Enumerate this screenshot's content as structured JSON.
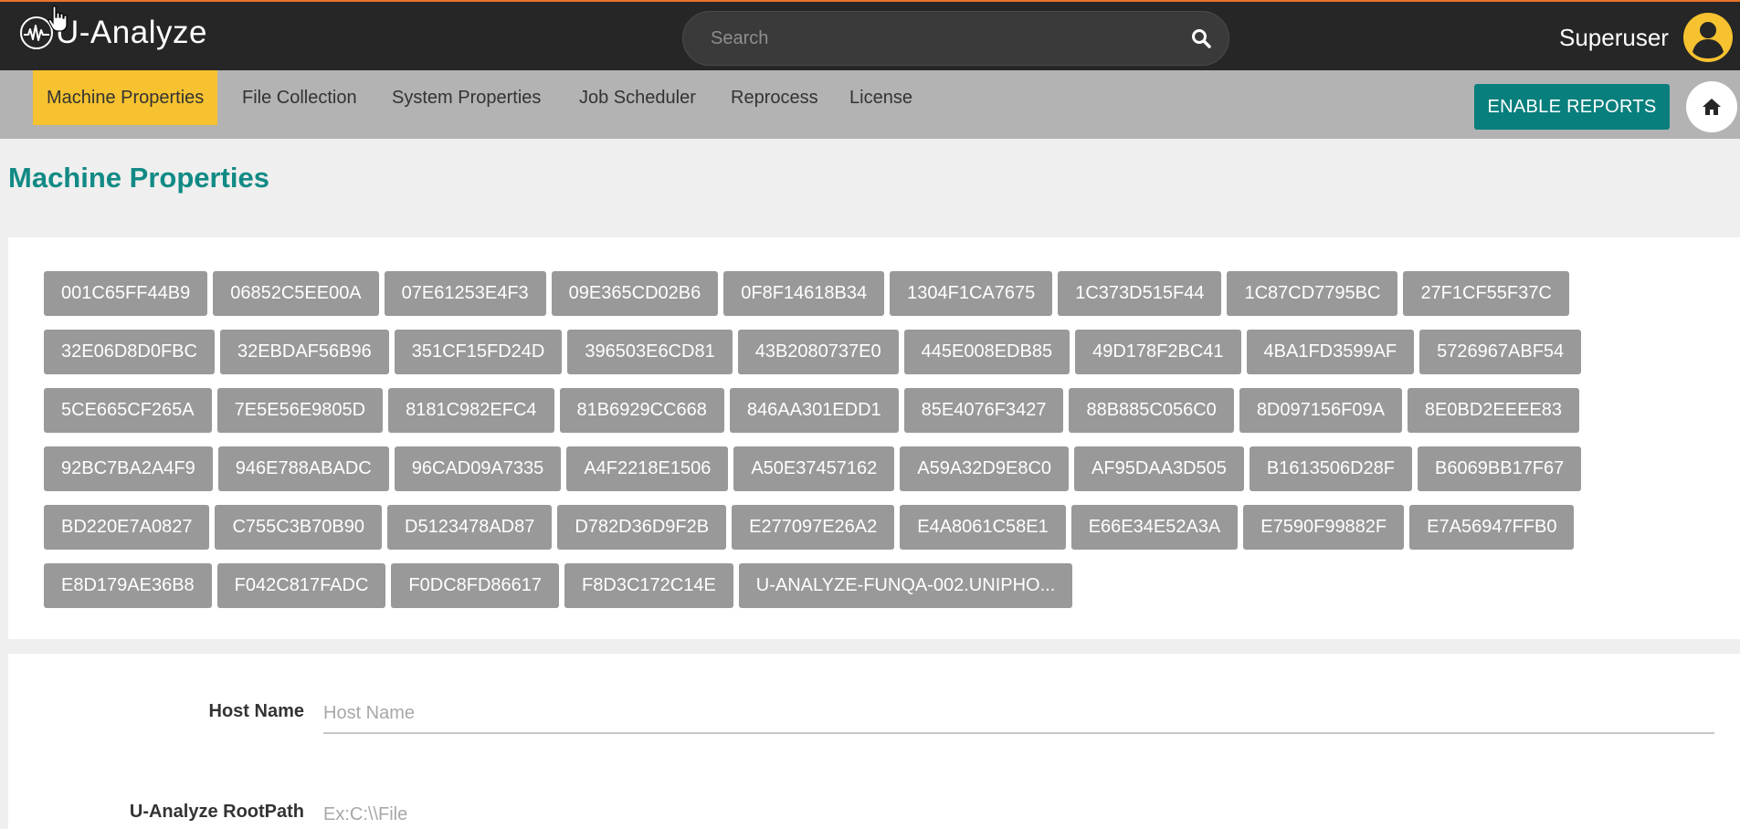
{
  "app": {
    "name": "U-Analyze"
  },
  "search": {
    "placeholder": "Search"
  },
  "user": {
    "name": "Superuser"
  },
  "nav": {
    "tabs": [
      {
        "label": "Machine Properties",
        "active": true
      },
      {
        "label": "File Collection"
      },
      {
        "label": "System Properties"
      },
      {
        "label": "Job Scheduler"
      },
      {
        "label": "Reprocess"
      },
      {
        "label": "License"
      }
    ],
    "enable_reports_label": "ENABLE REPORTS",
    "home_icon": "home-icon"
  },
  "page": {
    "title": "Machine Properties"
  },
  "machines": [
    [
      "001C65FF44B9",
      "06852C5EE00A",
      "07E61253E4F3",
      "09E365CD02B6",
      "0F8F14618B34",
      "1304F1CA7675",
      "1C373D515F44",
      "1C87CD7795BC",
      "27F1CF55F37C"
    ],
    [
      "32E06D8D0FBC",
      "32EBDAF56B96",
      "351CF15FD24D",
      "396503E6CD81",
      "43B2080737E0",
      "445E008EDB85",
      "49D178F2BC41",
      "4BA1FD3599AF",
      "5726967ABF54"
    ],
    [
      "5CE665CF265A",
      "7E5E56E9805D",
      "8181C982EFC4",
      "81B6929CC668",
      "846AA301EDD1",
      "85E4076F3427",
      "88B885C056C0",
      "8D097156F09A",
      "8E0BD2EEEE83"
    ],
    [
      "92BC7BA2A4F9",
      "946E788ABADC",
      "96CAD09A7335",
      "A4F2218E1506",
      "A50E37457162",
      "A59A32D9E8C0",
      "AF95DAA3D505",
      "B1613506D28F",
      "B6069BB17F67"
    ],
    [
      "BD220E7A0827",
      "C755C3B70B90",
      "D5123478AD87",
      "D782D36D9F2B",
      "E277097E26A2",
      "E4A8061C58E1",
      "E66E34E52A3A",
      "E7590F99882F",
      "E7A56947FFB0"
    ],
    [
      "E8D179AE36B8",
      "F042C817FADC",
      "F0DC8FD86617",
      "F8D3C172C14E",
      "U-ANALYZE-FUNQA-002.UNIPHO..."
    ]
  ],
  "form": {
    "host_name": {
      "label": "Host Name",
      "placeholder": "Host Name"
    },
    "root_path": {
      "label": "U-Analyze RootPath",
      "placeholder": "Ex:C:\\\\File"
    }
  },
  "colors": {
    "topbar": "#262626",
    "accent_orange": "#e8722c",
    "active_tab": "#f6c22f",
    "teal": "#087f7d",
    "title_teal": "#118a85",
    "chip": "#999999"
  }
}
